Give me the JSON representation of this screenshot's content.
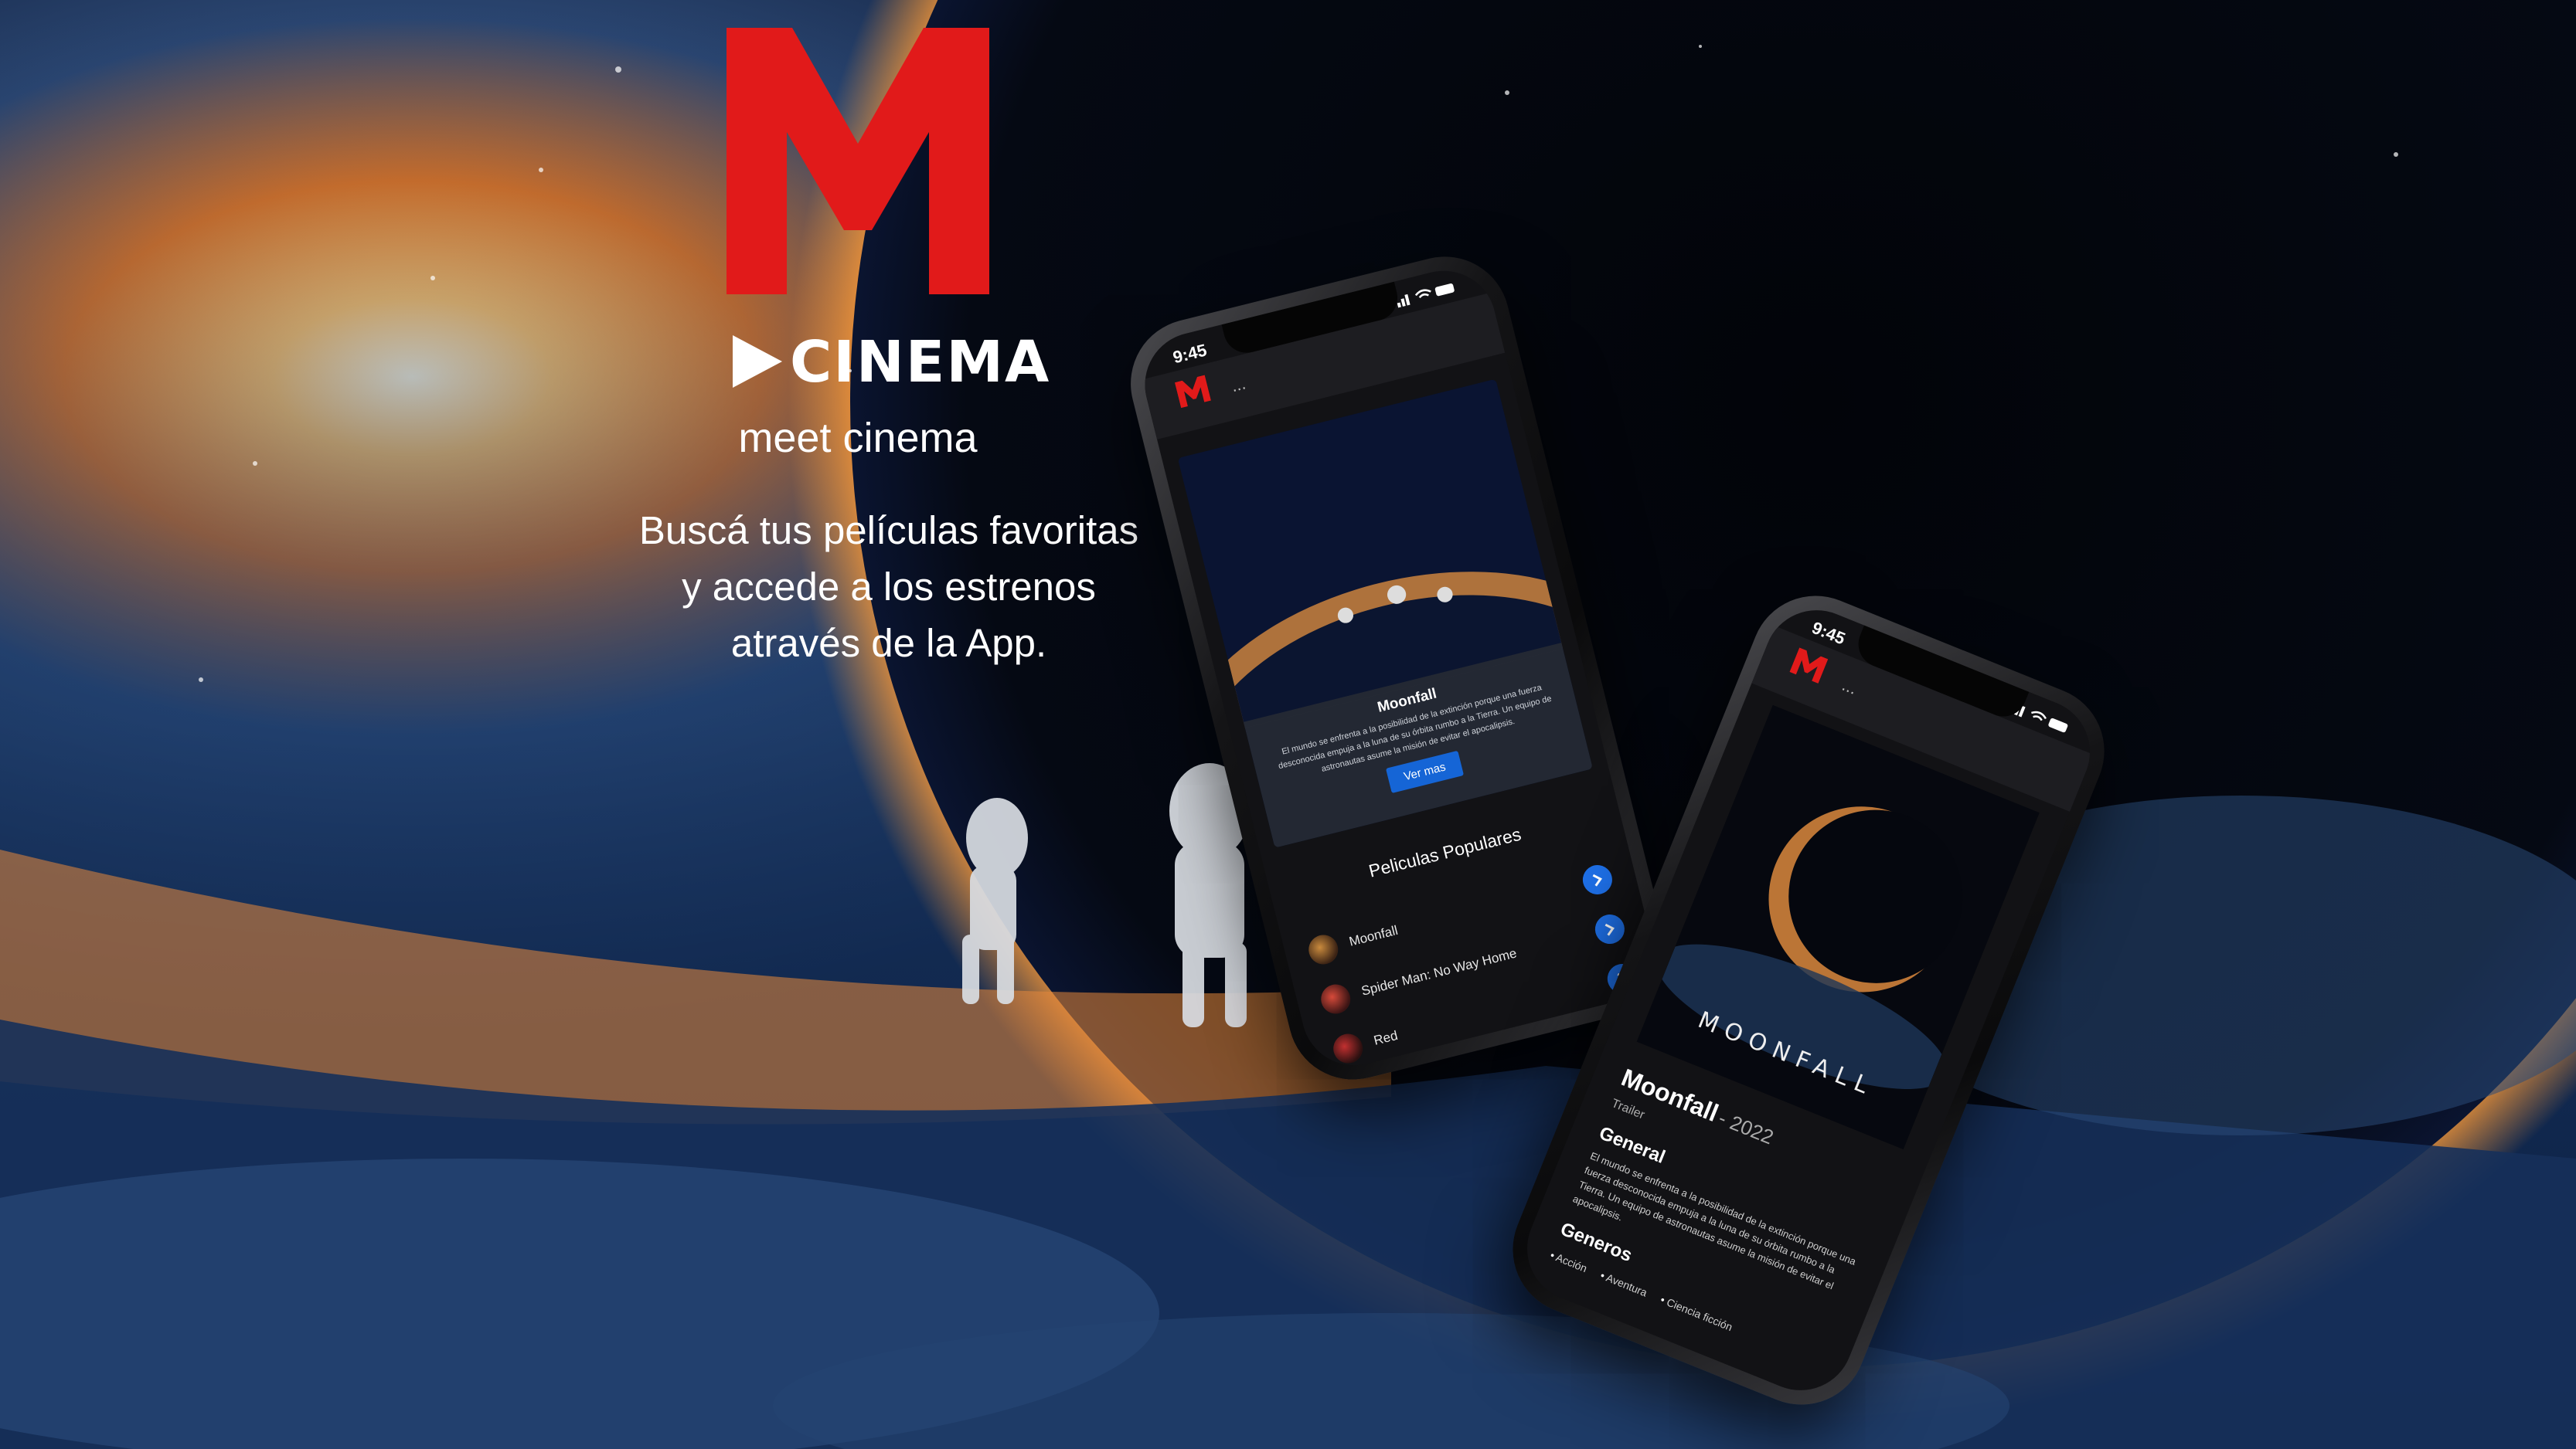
{
  "brand": {
    "logo_letter": "M",
    "name": "CINEMA",
    "tagline": "meet cinema",
    "brand_color": "#e11a1a"
  },
  "headline": {
    "lines": [
      "Buscá tus películas favoritas",
      "y accede a los estrenos",
      "através de la App."
    ]
  },
  "phone_home": {
    "status_time": "9:45",
    "menu": "...",
    "hero": {
      "title": "Moonfall",
      "description": "El mundo se enfrenta a la posibilidad de la extinción porque una fuerza desconocida empuja a la luna de su órbita rumbo a la Tierra. Un equipo de astronautas asume la misión de evitar el apocalipsis.",
      "button": "Ver mas"
    },
    "popular": {
      "title": "Peliculas Populares",
      "items": [
        {
          "label": "Moonfall"
        },
        {
          "label": "Spider Man: No Way Home"
        },
        {
          "label": "Red"
        }
      ]
    }
  },
  "phone_detail": {
    "status_time": "9:45",
    "menu": "...",
    "poster_title": "MOONFALL",
    "title": "Moonfall",
    "year": "- 2022",
    "trailer": "Trailer",
    "general_heading": "General",
    "general_text": "El mundo se enfrenta a la posibilidad de la extinción porque una fuerza desconocida empuja a la luna de su órbita rumbo a la Tierra. Un equipo de astronautas asume la misión de evitar el apocalipsis.",
    "genres_heading": "Generos",
    "genres": [
      "Acción",
      "Aventura",
      "Ciencia ficción"
    ]
  },
  "colors": {
    "accent_blue": "#1e6fe6",
    "brand_red": "#e11a1a",
    "background": "#050b1c"
  },
  "icons": [
    "play-icon",
    "chevron-right-icon",
    "signal-icon",
    "wifi-icon",
    "battery-icon"
  ]
}
